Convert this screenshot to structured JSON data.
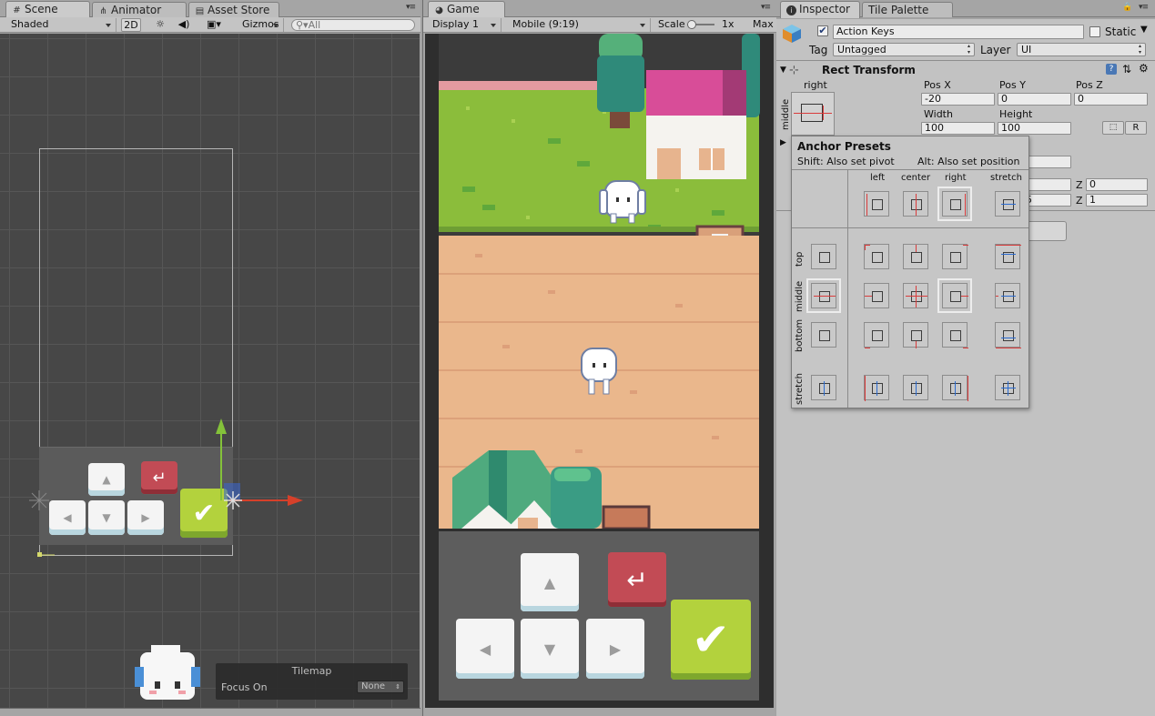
{
  "scene": {
    "tabs": [
      {
        "label": "Scene",
        "icon": "#",
        "active": true
      },
      {
        "label": "Animator",
        "icon": "⋔",
        "active": false
      },
      {
        "label": "Asset Store",
        "icon": "▤",
        "active": false
      }
    ],
    "toolbar": {
      "shading": "Shaded",
      "mode_2d": "2D",
      "gizmos": "Gizmos",
      "search_placeholder": "All"
    },
    "tilemap_overlay": {
      "title": "Tilemap",
      "focus_label": "Focus On",
      "focus_value": "None"
    }
  },
  "game": {
    "tab": {
      "label": "Game",
      "icon": "◕"
    },
    "toolbar": {
      "display": "Display 1",
      "resolution": "Mobile (9:19)",
      "scale_label": "Scale",
      "scale_value": "1x",
      "maximize": "Max"
    }
  },
  "inspector": {
    "tabs": [
      {
        "label": "Inspector",
        "icon": "i",
        "active": true
      },
      {
        "label": "Tile Palette",
        "active": false
      }
    ],
    "object": {
      "name": "Action Keys",
      "active": true,
      "static_label": "Static",
      "tag_label": "Tag",
      "tag_value": "Untagged",
      "layer_label": "Layer",
      "layer_value": "UI"
    },
    "rect_transform": {
      "title": "Rect Transform",
      "anchor_h": "right",
      "anchor_v": "middle",
      "fields": [
        {
          "label": "Pos X",
          "value": "-20"
        },
        {
          "label": "Pos Y",
          "value": "0"
        },
        {
          "label": "Pos Z",
          "value": "0"
        },
        {
          "label": "Width",
          "value": "100"
        },
        {
          "label": "Height",
          "value": "100"
        }
      ],
      "raw_button": "R",
      "z_labels": [
        "Z",
        "Z"
      ],
      "z_values": [
        "0",
        "1"
      ],
      "partial_value": "5"
    },
    "anchor_presets": {
      "title": "Anchor Presets",
      "hint_shift": "Shift: Also set pivot",
      "hint_alt": "Alt: Also set position",
      "columns": [
        "left",
        "center",
        "right",
        "stretch"
      ],
      "rows": [
        "top",
        "middle",
        "bottom",
        "stretch"
      ]
    }
  }
}
